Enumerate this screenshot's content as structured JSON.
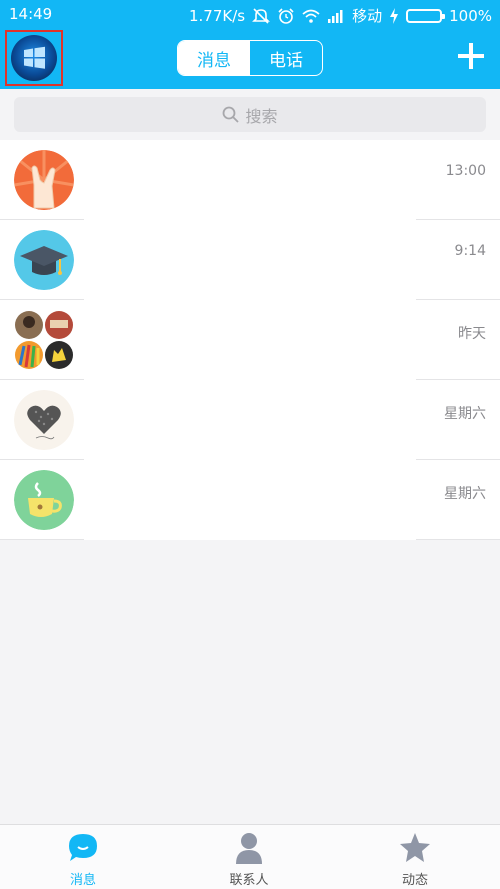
{
  "status_bar": {
    "time": "14:49",
    "network_speed": "1.77K/s",
    "carrier": "移动",
    "battery": "100%",
    "icons": [
      "mute-icon",
      "alarm-icon",
      "wifi-icon",
      "signal-icon",
      "charging-icon",
      "battery-icon"
    ]
  },
  "header": {
    "tabs": [
      {
        "label": "消息",
        "active": true
      },
      {
        "label": "电话",
        "active": false
      }
    ],
    "add_icon": "plus-icon"
  },
  "search": {
    "placeholder": "搜索",
    "icon": "search-icon"
  },
  "conversations": [
    {
      "time": "13:00",
      "avatar": "rock-hand-avatar"
    },
    {
      "time": "9:14",
      "avatar": "graduation-cap-avatar"
    },
    {
      "time": "昨天",
      "avatar": "group-collage-avatar"
    },
    {
      "time": "星期六",
      "avatar": "heart-avatar"
    },
    {
      "time": "星期六",
      "avatar": "coffee-cup-avatar"
    }
  ],
  "tab_bar": {
    "items": [
      {
        "label": "消息",
        "icon": "message-bubble-icon",
        "active": true
      },
      {
        "label": "联系人",
        "icon": "contact-person-icon",
        "active": false
      },
      {
        "label": "动态",
        "icon": "star-icon",
        "active": false
      }
    ]
  },
  "colors": {
    "accent": "#12b7f5",
    "background": "#f4f4f6"
  }
}
